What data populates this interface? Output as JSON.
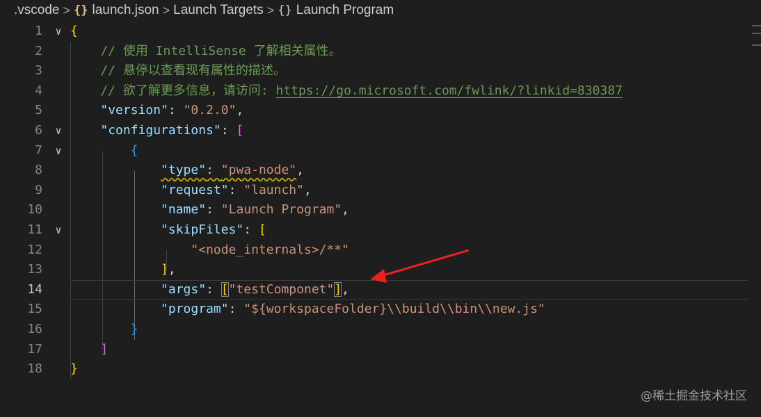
{
  "breadcrumb": {
    "folder": ".vscode",
    "file_icon": "{}",
    "file": "launch.json",
    "section": "Launch Targets",
    "object_icon": "{}",
    "item": "Launch Program"
  },
  "editor": {
    "active_line": "14",
    "lines": [
      {
        "num": "1",
        "fold": "∨",
        "tokens": [
          {
            "t": "{",
            "c": "c-brace1"
          }
        ]
      },
      {
        "num": "2",
        "fold": "",
        "tokens": [
          {
            "t": "    // 使用 IntelliSense 了解相关属性。",
            "c": "c-comment"
          }
        ]
      },
      {
        "num": "3",
        "fold": "",
        "tokens": [
          {
            "t": "    // 悬停以查看现有属性的描述。",
            "c": "c-comment"
          }
        ]
      },
      {
        "num": "4",
        "fold": "",
        "tokens": [
          {
            "t": "    // 欲了解更多信息，请访问: ",
            "c": "c-comment"
          },
          {
            "t": "https://go.microsoft.com/fwlink/?linkid=830387",
            "c": "c-link"
          }
        ]
      },
      {
        "num": "5",
        "fold": "",
        "tokens": [
          {
            "t": "    "
          },
          {
            "t": "\"version\"",
            "c": "c-key"
          },
          {
            "t": ": ",
            "c": "c-punc"
          },
          {
            "t": "\"0.2.0\"",
            "c": "c-str"
          },
          {
            "t": ",",
            "c": "c-punc"
          }
        ]
      },
      {
        "num": "6",
        "fold": "∨",
        "tokens": [
          {
            "t": "    "
          },
          {
            "t": "\"configurations\"",
            "c": "c-key"
          },
          {
            "t": ": ",
            "c": "c-punc"
          },
          {
            "t": "[",
            "c": "c-brace2"
          }
        ]
      },
      {
        "num": "7",
        "fold": "∨",
        "tokens": [
          {
            "t": "        "
          },
          {
            "t": "{",
            "c": "c-brace3"
          }
        ]
      },
      {
        "num": "8",
        "fold": "",
        "tokens": [
          {
            "t": "            "
          },
          {
            "t": "\"type\"",
            "c": "c-key squiggle"
          },
          {
            "t": ": ",
            "c": "c-punc squiggle"
          },
          {
            "t": "\"pwa-node\"",
            "c": "c-str squiggle"
          },
          {
            "t": ",",
            "c": "c-punc"
          }
        ]
      },
      {
        "num": "9",
        "fold": "",
        "tokens": [
          {
            "t": "            "
          },
          {
            "t": "\"request\"",
            "c": "c-key"
          },
          {
            "t": ": ",
            "c": "c-punc"
          },
          {
            "t": "\"launch\"",
            "c": "c-str"
          },
          {
            "t": ",",
            "c": "c-punc"
          }
        ]
      },
      {
        "num": "10",
        "fold": "",
        "tokens": [
          {
            "t": "            "
          },
          {
            "t": "\"name\"",
            "c": "c-key"
          },
          {
            "t": ": ",
            "c": "c-punc"
          },
          {
            "t": "\"Launch Program\"",
            "c": "c-str"
          },
          {
            "t": ",",
            "c": "c-punc"
          }
        ]
      },
      {
        "num": "11",
        "fold": "∨",
        "tokens": [
          {
            "t": "            "
          },
          {
            "t": "\"skipFiles\"",
            "c": "c-key"
          },
          {
            "t": ": ",
            "c": "c-punc"
          },
          {
            "t": "[",
            "c": "c-brace1"
          }
        ]
      },
      {
        "num": "12",
        "fold": "",
        "tokens": [
          {
            "t": "                "
          },
          {
            "t": "\"<node_internals>/**\"",
            "c": "c-str"
          }
        ]
      },
      {
        "num": "13",
        "fold": "",
        "tokens": [
          {
            "t": "            "
          },
          {
            "t": "]",
            "c": "c-brace1"
          },
          {
            "t": ",",
            "c": "c-punc"
          }
        ]
      },
      {
        "num": "14",
        "fold": "",
        "tokens": [
          {
            "t": "            "
          },
          {
            "t": "\"args\"",
            "c": "c-key"
          },
          {
            "t": ": ",
            "c": "c-punc"
          },
          {
            "t": "[",
            "c": "c-brace1 bracket-match"
          },
          {
            "t": "\"testComponet\"",
            "c": "c-str"
          },
          {
            "t": "]",
            "c": "c-brace1 bracket-match"
          },
          {
            "t": ",",
            "c": "c-punc"
          }
        ]
      },
      {
        "num": "15",
        "fold": "",
        "tokens": [
          {
            "t": "            "
          },
          {
            "t": "\"program\"",
            "c": "c-key"
          },
          {
            "t": ": ",
            "c": "c-punc"
          },
          {
            "t": "\"${workspaceFolder}\\\\build\\\\bin\\\\new.js\"",
            "c": "c-str"
          }
        ]
      },
      {
        "num": "16",
        "fold": "",
        "tokens": [
          {
            "t": "        "
          },
          {
            "t": "}",
            "c": "c-brace3"
          }
        ]
      },
      {
        "num": "17",
        "fold": "",
        "tokens": [
          {
            "t": "    "
          },
          {
            "t": "]",
            "c": "c-brace2"
          }
        ]
      },
      {
        "num": "18",
        "fold": "",
        "tokens": [
          {
            "t": "{}",
            "c": "c-brace1"
          }
        ]
      }
    ]
  },
  "colors": {
    "background": "#1e1e1e",
    "comment": "#6a9955",
    "key": "#9cdcfe",
    "string": "#ce9178",
    "bracket_level1": "#ffd700",
    "bracket_level2": "#da70d6",
    "bracket_level3": "#179fff",
    "annotation_arrow": "#e8231f"
  },
  "watermark": "@稀土掘金技术社区"
}
